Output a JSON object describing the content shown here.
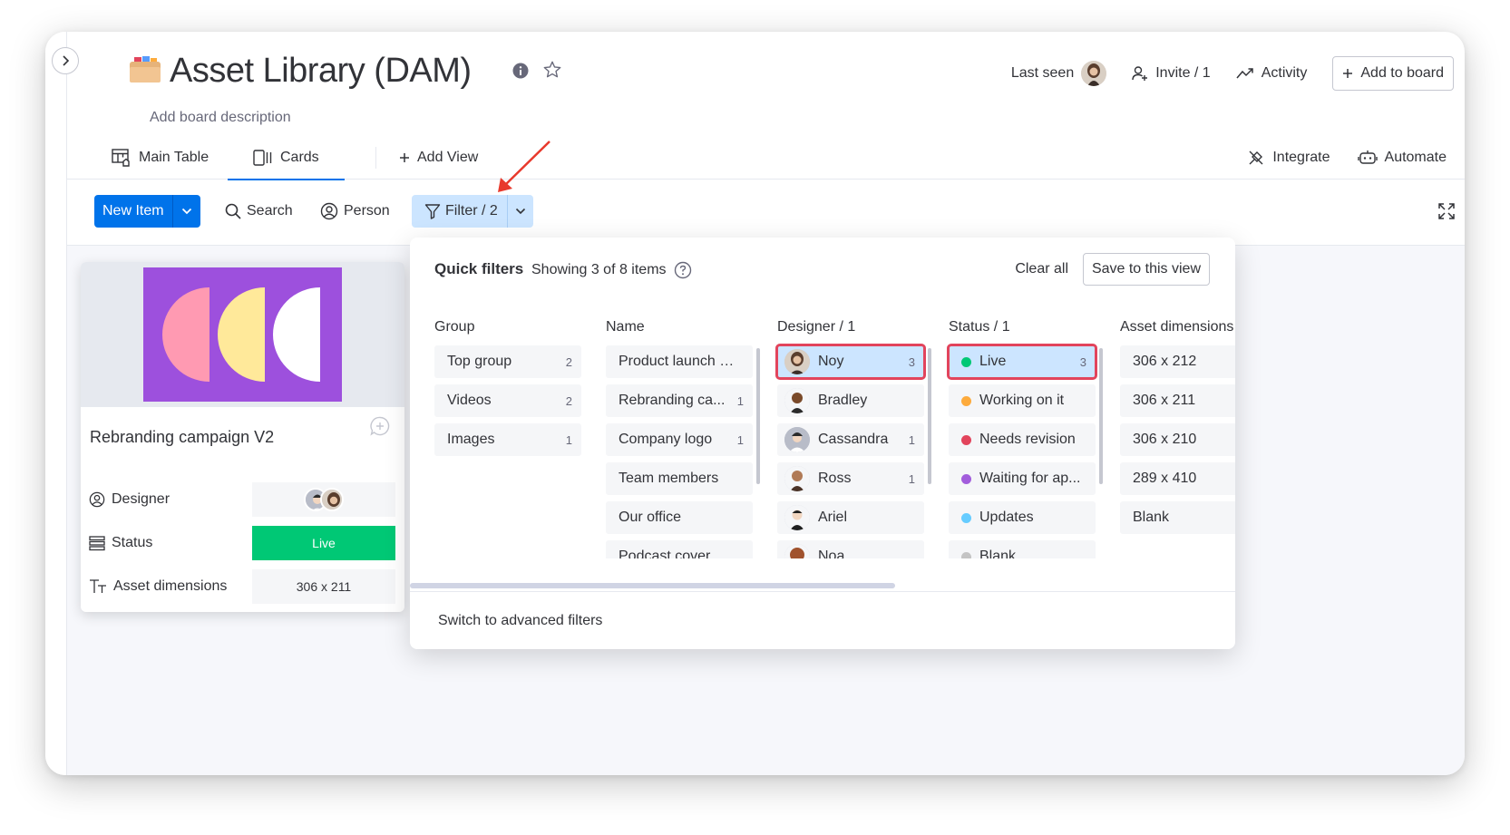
{
  "board": {
    "title": "Asset Library (DAM)",
    "description": "Add board description"
  },
  "header": {
    "last_seen": "Last seen",
    "invite": "Invite / 1",
    "activity": "Activity",
    "add_to_board": "Add to board"
  },
  "tabs": {
    "main_table": "Main Table",
    "cards": "Cards",
    "add_view": "Add View",
    "integrate": "Integrate",
    "automate": "Automate"
  },
  "toolbar": {
    "new_item": "New Item",
    "search": "Search",
    "person": "Person",
    "filter": "Filter / 2"
  },
  "card": {
    "title": "Rebranding campaign V2",
    "fields": [
      {
        "label": "Designer",
        "value": ""
      },
      {
        "label": "Status",
        "value": "Live"
      },
      {
        "label": "Asset dimensions",
        "value": "306 x 211"
      }
    ]
  },
  "quick_filters": {
    "title": "Quick filters",
    "showing": "Showing 3 of 8 items",
    "clear_all": "Clear all",
    "save_view": "Save to this view",
    "advanced": "Switch to advanced filters",
    "columns": [
      {
        "header": "Group",
        "options": [
          {
            "label": "Top group",
            "count": "2"
          },
          {
            "label": "Videos",
            "count": "2"
          },
          {
            "label": "Images",
            "count": "1"
          }
        ]
      },
      {
        "header": "Name",
        "options": [
          {
            "label": "Product launch vi...",
            "count": ""
          },
          {
            "label": "Rebranding ca...",
            "count": "1"
          },
          {
            "label": "Company logo",
            "count": "1"
          },
          {
            "label": "Team members",
            "count": ""
          },
          {
            "label": "Our office",
            "count": ""
          },
          {
            "label": "Podcast cover",
            "count": ""
          }
        ]
      },
      {
        "header": "Designer / 1",
        "options": [
          {
            "label": "Noy",
            "count": "3",
            "selected": true
          },
          {
            "label": "Bradley",
            "count": ""
          },
          {
            "label": "Cassandra",
            "count": "1"
          },
          {
            "label": "Ross",
            "count": "1"
          },
          {
            "label": "Ariel",
            "count": ""
          },
          {
            "label": "Noa",
            "count": ""
          }
        ]
      },
      {
        "header": "Status / 1",
        "options": [
          {
            "label": "Live",
            "count": "3",
            "color": "#00c875",
            "selected": true
          },
          {
            "label": "Working on it",
            "count": "",
            "color": "#fdab3d"
          },
          {
            "label": "Needs revision",
            "count": "",
            "color": "#e2445c"
          },
          {
            "label": "Waiting for ap...",
            "count": "",
            "color": "#a25ddc"
          },
          {
            "label": "Updates",
            "count": "",
            "color": "#66ccff"
          },
          {
            "label": "Blank",
            "count": "",
            "color": "#c4c4c4"
          }
        ]
      },
      {
        "header": "Asset dimensions",
        "options": [
          {
            "label": "306 x 212",
            "count": ""
          },
          {
            "label": "306 x 211",
            "count": ""
          },
          {
            "label": "306 x 210",
            "count": ""
          },
          {
            "label": "289 x 410",
            "count": ""
          },
          {
            "label": "Blank",
            "count": ""
          }
        ]
      }
    ]
  },
  "colors": {
    "primary": "#0073ea",
    "filter_active_bg": "#cce5ff",
    "highlight_border": "#e2445c",
    "status_live": "#00c875",
    "card_art_bg": "#9d50dd"
  }
}
